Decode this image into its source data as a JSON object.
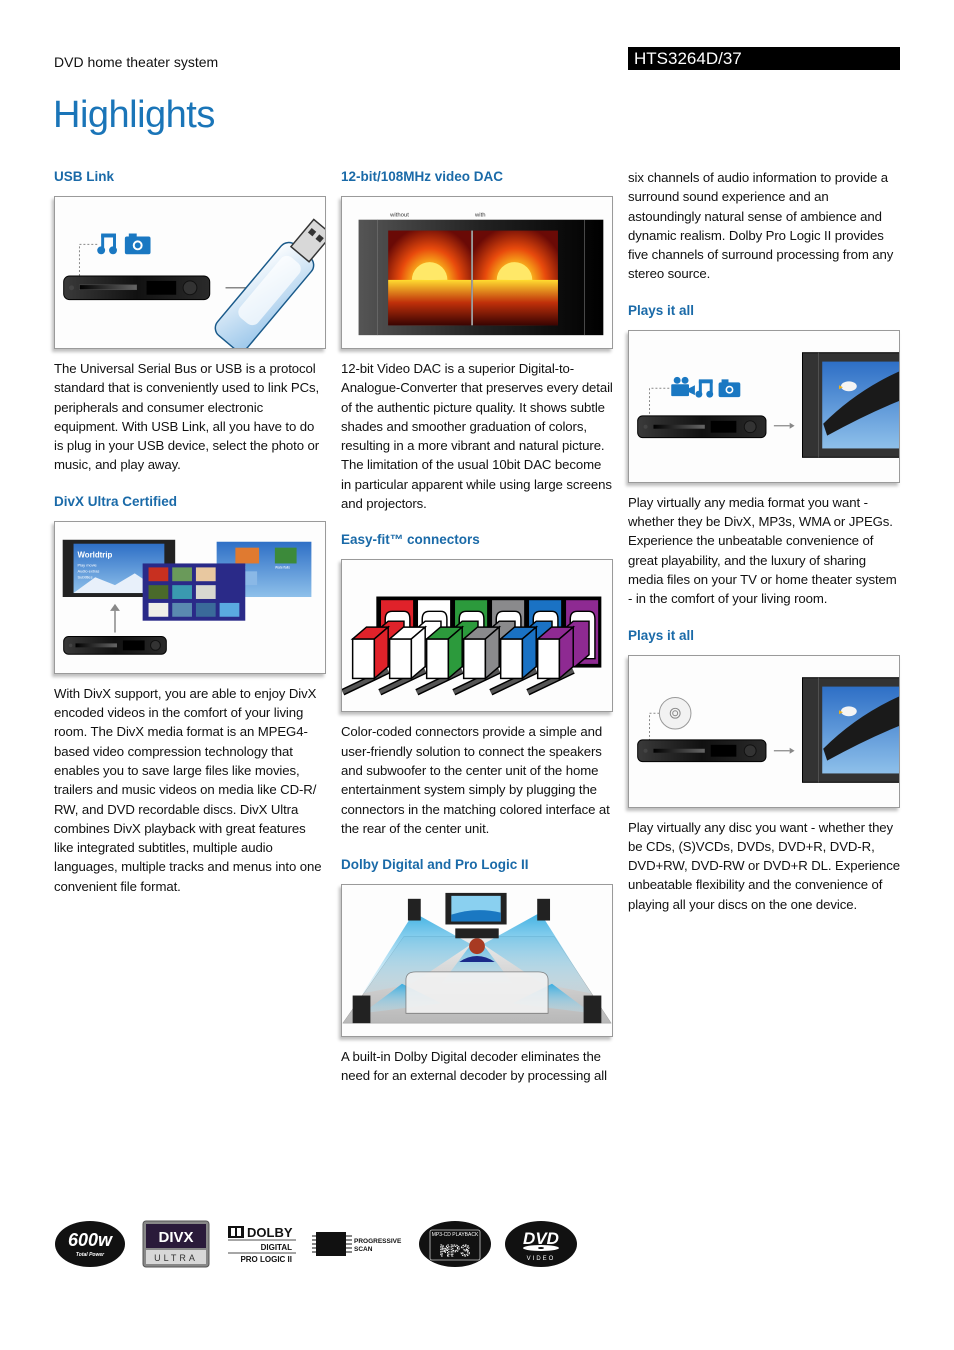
{
  "header": {
    "category": "DVD home theater system",
    "model": "HTS3264D/37",
    "title": "Highlights"
  },
  "colors": {
    "accent": "#1a75b8",
    "heading": "#1a6aa8",
    "model_bar": "#000000"
  },
  "sections": {
    "usb": {
      "title": "USB Link",
      "figure": "usb-link-illustration",
      "body": "The Universal Serial Bus or USB is a protocol standard that is conveniently used to link PCs, peripherals and consumer electronic equipment. With USB Link, all you have to do is plug in your USB device, select the photo or music, and play away."
    },
    "divx": {
      "title": "DivX Ultra Certified",
      "figure": "divx-menu-illustration",
      "menu_title": "Worldtrip",
      "menu_items": [
        "Play movie",
        "Audio extras",
        "Subtitles"
      ],
      "thumb_labels": [
        "Desert",
        "Waterfalls"
      ],
      "body": "With DivX support, you are able to enjoy DivX encoded videos in the comfort of your living room. The DivX media format is an MPEG4-based video compression technology that enables you to save large files like movies, trailers and music videos on media like CD-R/ RW, and DVD recordable discs. DivX Ultra combines DivX playback with great features like integrated subtitles, multiple audio languages, multiple tracks and menus into one convenient file format."
    },
    "dac": {
      "title": "12-bit/108MHz video DAC",
      "figure": "sunset-comparison-illustration",
      "label_without": "without",
      "label_with": "with",
      "body": "12-bit Video DAC is a superior Digital-to-Analogue-Converter that preserves every detail of the authentic picture quality. It shows subtle shades and smoother graduation of colors, resulting in a more vibrant and natural picture. The limitation of the usual 10bit DAC become in particular apparent while using large screens and projectors."
    },
    "easyfit": {
      "title": "Easy-fit™ connectors",
      "figure": "color-coded-connectors-illustration",
      "connector_colors": [
        "#e0222a",
        "#ffffff",
        "#2c9a3c",
        "#8a8a8c",
        "#1a72c4",
        "#8e2a92"
      ],
      "body": "Color-coded connectors provide a simple and user-friendly solution to connect the speakers and subwoofer to the center unit of the home entertainment system simply by plugging the connectors in the matching colored interface at the rear of the center unit."
    },
    "dolby": {
      "title": "Dolby Digital and Pro Logic II",
      "figure": "surround-room-illustration",
      "body": "A built-in Dolby Digital decoder eliminates the need for an external decoder by processing all",
      "body_cont": "six channels of audio information to provide a surround sound experience and an astoundingly natural sense of ambience and dynamic realism. Dolby Pro Logic II provides five channels of surround processing from any stereo source."
    },
    "plays_media": {
      "title": "Plays it all",
      "figure": "media-to-tv-illustration",
      "body": "Play virtually any media format you want - whether they be DivX, MP3s, WMA or JPEGs. Experience the unbeatable convenience of great playability, and the luxury of sharing media files on your TV or home theater system - in the comfort of your living room."
    },
    "plays_disc": {
      "title": "Plays it all",
      "figure": "disc-to-tv-illustration",
      "body": "Play virtually any disc you want - whether they be CDs, (S)VCDs, DVDs, DVD+R, DVD-R, DVD+RW, DVD-RW or DVD+R DL. Experience unbeatable flexibility and the convenience of playing all your discs on the one device."
    }
  },
  "logos": {
    "power": {
      "value": "600w",
      "caption": "Total Power"
    },
    "divx": {
      "top": "DIVX",
      "bottom": "ULTRA"
    },
    "dolby": {
      "brand": "DOLBY",
      "line1": "DIGITAL",
      "line2": "PRO LOGIC II"
    },
    "progressive": {
      "line1": "PROGRESSIVE",
      "line2": "SCAN"
    },
    "mp3": {
      "caption": "MP3-CD PLAYBACK",
      "text": "MP3"
    },
    "dvd": {
      "text": "DVD",
      "caption": "VIDEO"
    }
  }
}
